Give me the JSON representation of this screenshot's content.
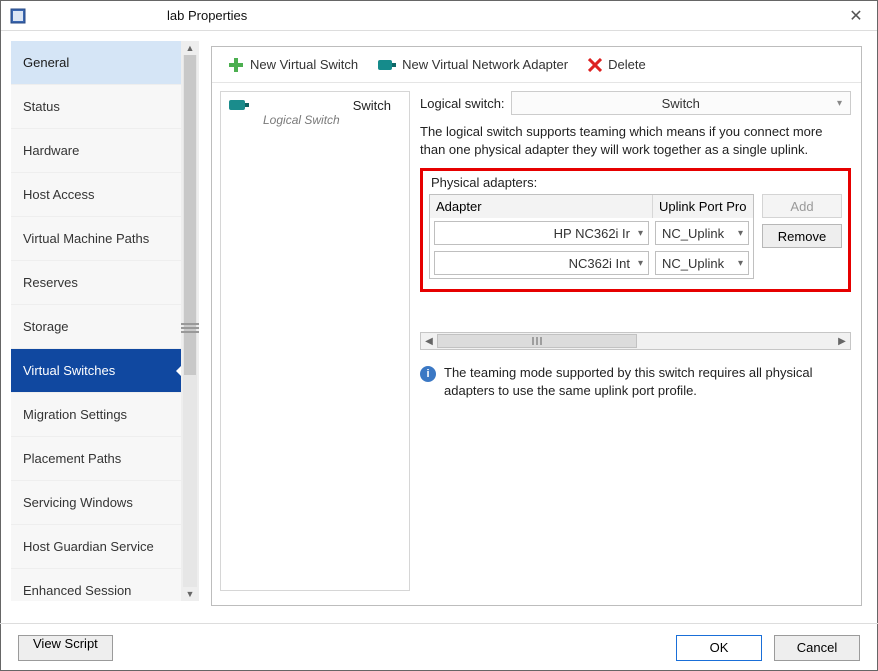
{
  "window": {
    "title": "lab Properties",
    "close_glyph": "✕"
  },
  "sidebar": {
    "items": [
      {
        "label": "General"
      },
      {
        "label": "Status"
      },
      {
        "label": "Hardware"
      },
      {
        "label": "Host Access"
      },
      {
        "label": "Virtual Machine Paths"
      },
      {
        "label": "Reserves"
      },
      {
        "label": "Storage"
      },
      {
        "label": "Virtual Switches"
      },
      {
        "label": "Migration Settings"
      },
      {
        "label": "Placement Paths"
      },
      {
        "label": "Servicing Windows"
      },
      {
        "label": "Host Guardian Service"
      },
      {
        "label": "Enhanced Session"
      }
    ],
    "selected_index": 7
  },
  "toolbar": {
    "new_switch": "New Virtual Switch",
    "new_adapter": "New Virtual Network Adapter",
    "delete": "Delete"
  },
  "switchlist": {
    "items": [
      {
        "name": "Switch",
        "subtitle": "Logical Switch"
      }
    ]
  },
  "rpane": {
    "logical_label": "Logical switch:",
    "logical_value": "Switch",
    "description": "The logical switch supports teaming which means if you connect more than one physical adapter they will work together as a single uplink.",
    "group_label": "Physical adapters:",
    "columns": {
      "adapter": "Adapter",
      "uplink": "Uplink Port Pro"
    },
    "rows": [
      {
        "adapter": "HP NC362i Ir",
        "uplink": "NC_Uplink"
      },
      {
        "adapter": "NC362i Int",
        "uplink": "NC_Uplink"
      }
    ],
    "buttons": {
      "add": "Add",
      "remove": "Remove"
    },
    "info": "The teaming mode supported by this switch requires all physical adapters to use the same uplink port profile."
  },
  "footer": {
    "view_script": "View Script",
    "ok": "OK",
    "cancel": "Cancel"
  }
}
